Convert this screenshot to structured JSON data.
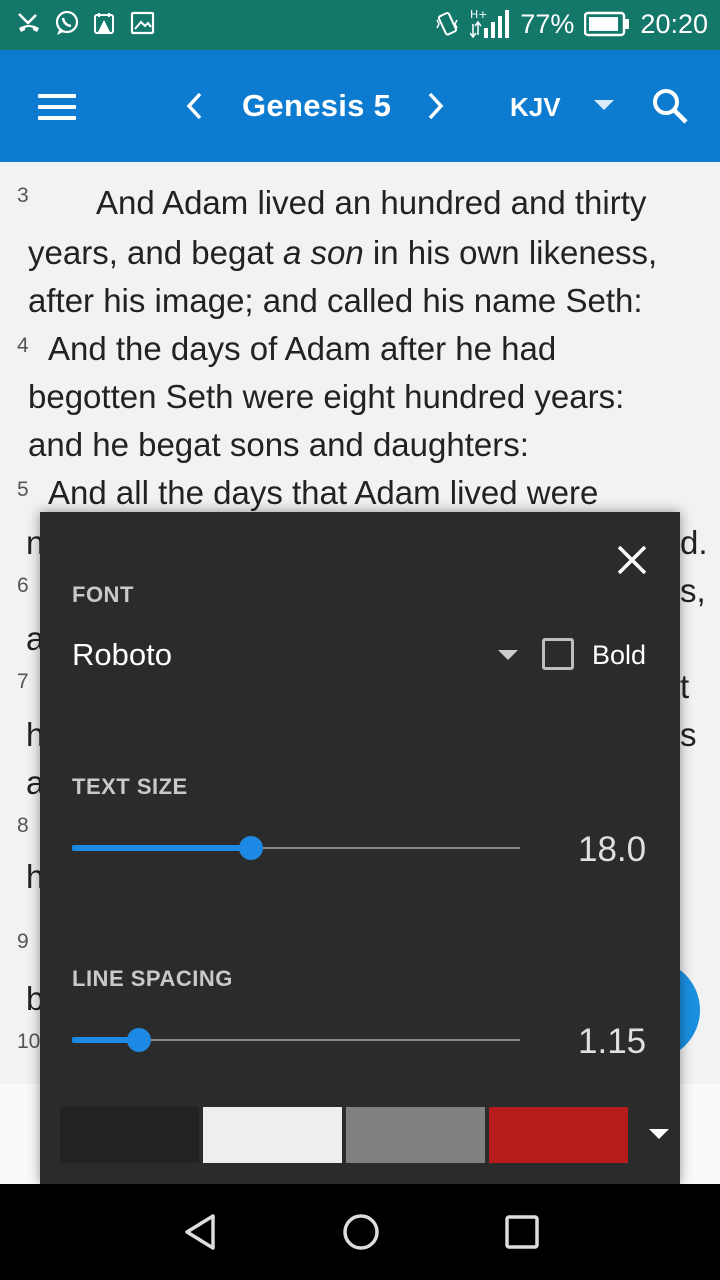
{
  "status_bar": {
    "battery_percent": "77%",
    "time": "20:20",
    "network": "H+"
  },
  "header": {
    "title": "Genesis 5",
    "version": "KJV"
  },
  "reader": {
    "verses": [
      {
        "num": "3",
        "lines": [
          "And Adam lived an hundred and thirty",
          "years, and begat ",
          "after his image; and called his name Seth:"
        ],
        "italic": "a son",
        "after_italic": " in his own likeness,"
      },
      {
        "num": "4",
        "lines": [
          "And the days of Adam after he had",
          "begotten Seth were eight hundred years:",
          "and he begat sons and daughters:"
        ]
      },
      {
        "num": "5",
        "lines": [
          "And all the days that Adam lived were"
        ]
      }
    ],
    "hidden_verse_numbers": [
      "6",
      "7",
      "8",
      "9",
      "10"
    ],
    "edge_fragments": [
      "n",
      "d.",
      "s,",
      "a",
      "t",
      "h",
      "s",
      "a",
      "h",
      "b"
    ]
  },
  "settings_panel": {
    "font_label": "FONT",
    "font_value": "Roboto",
    "bold_label": "Bold",
    "bold_checked": false,
    "text_size_label": "TEXT SIZE",
    "text_size_value": "18.0",
    "text_size_fraction": 0.4,
    "line_spacing_label": "LINE SPACING",
    "line_spacing_value": "1.15",
    "line_spacing_fraction": 0.15,
    "color_swatches": [
      "#222222",
      "#eeeeee",
      "#808080",
      "#b71c1c"
    ]
  },
  "colors": {
    "status_bar": "#13776a",
    "app_bar": "#0c7bd0",
    "accent": "#1e88e5",
    "panel": "#2b2b2b"
  }
}
